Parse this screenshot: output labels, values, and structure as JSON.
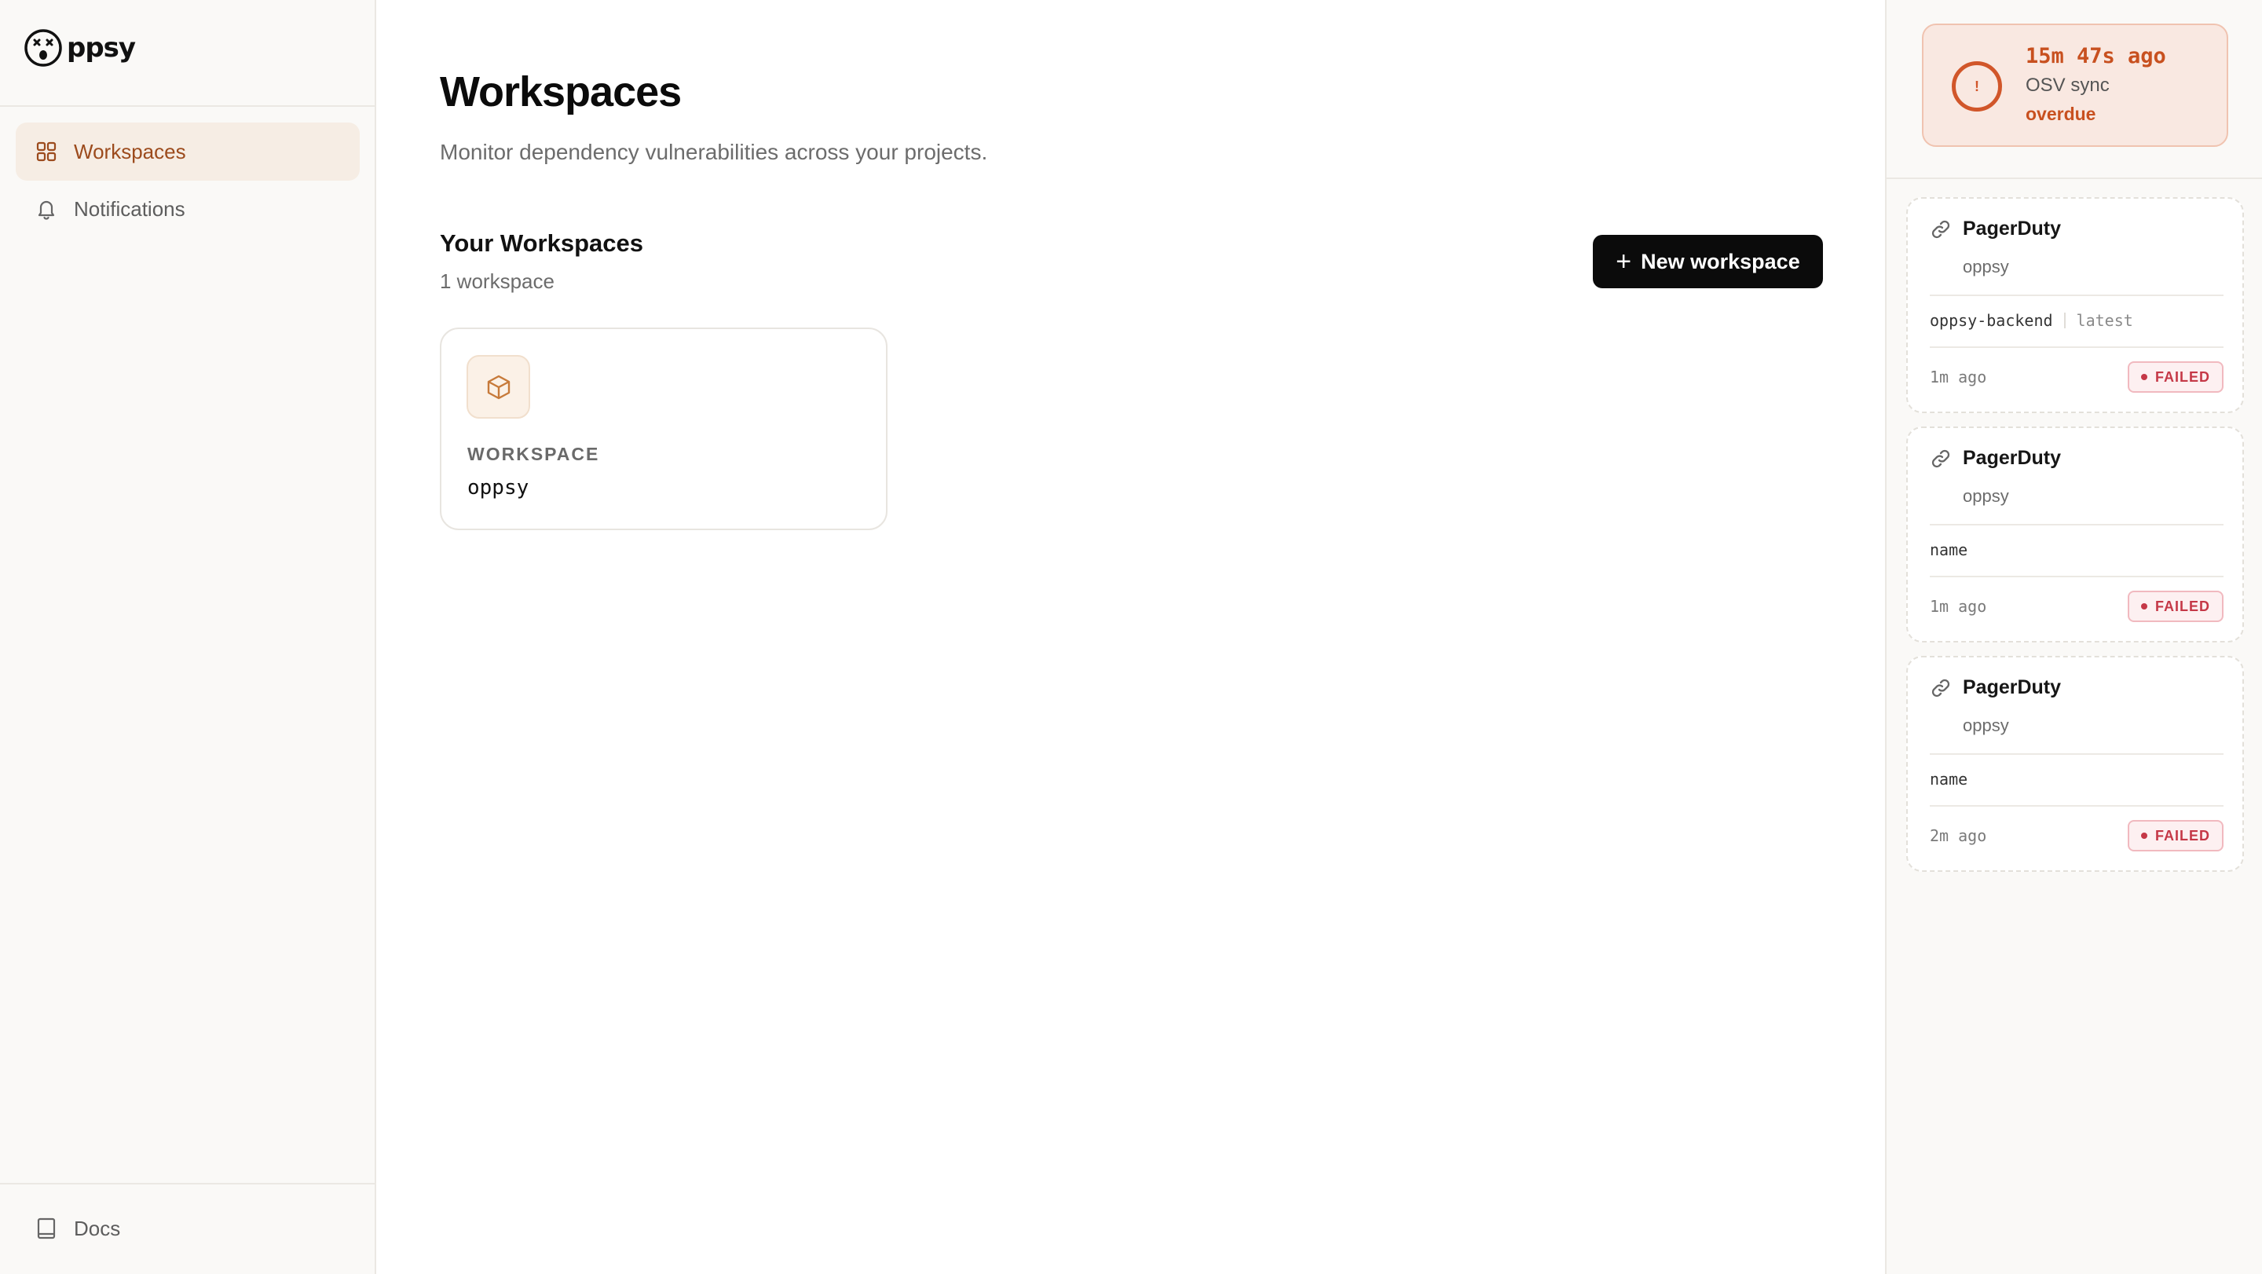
{
  "app": {
    "name": "ppsy"
  },
  "sidebar": {
    "items": [
      {
        "label": "Workspaces",
        "icon": "grid-icon",
        "active": true
      },
      {
        "label": "Notifications",
        "icon": "bell-icon",
        "active": false
      }
    ],
    "footer": {
      "label": "Docs",
      "icon": "book-icon"
    }
  },
  "main": {
    "title": "Workspaces",
    "subtitle": "Monitor dependency vulnerabilities across your projects.",
    "section_title": "Your Workspaces",
    "section_count": "1 workspace",
    "new_button": {
      "label": "New workspace",
      "icon": "plus"
    },
    "workspaces": [
      {
        "label": "WORKSPACE",
        "name": "oppsy",
        "icon": "box-icon"
      }
    ]
  },
  "sync": {
    "time": "15m 47s ago",
    "name": "OSV sync",
    "status": "overdue",
    "icon": "!",
    "color": "#c8501f"
  },
  "alerts": [
    {
      "integration": "PagerDuty",
      "workspace": "oppsy",
      "target": "oppsy-backend",
      "tag": "latest",
      "time": "1m ago",
      "status": "FAILED"
    },
    {
      "integration": "PagerDuty",
      "workspace": "oppsy",
      "target": "name",
      "tag": "",
      "time": "1m ago",
      "status": "FAILED"
    },
    {
      "integration": "PagerDuty",
      "workspace": "oppsy",
      "target": "name",
      "tag": "",
      "time": "2m ago",
      "status": "FAILED"
    }
  ],
  "colors": {
    "accent": "#9c4b1d",
    "active_bg": "#f6ede4",
    "failed": "#c53847",
    "button_bg": "#0b0b0b"
  }
}
